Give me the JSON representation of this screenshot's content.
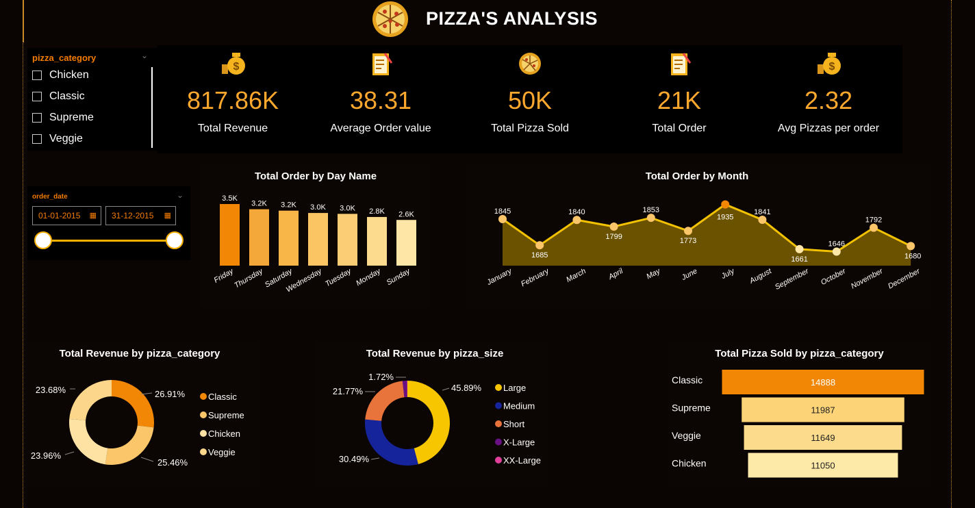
{
  "header": {
    "title": "PIZZA'S  ANALYSIS"
  },
  "slicer": {
    "title": "pizza_category",
    "options": [
      "Chicken",
      "Classic",
      "Supreme",
      "Veggie"
    ]
  },
  "date_slicer": {
    "title": "order_date",
    "start": "01-01-2015",
    "end": "31-12-2015"
  },
  "kpis": [
    {
      "value": "817.86K",
      "label": "Total Revenue",
      "icon": "money-bag-icon"
    },
    {
      "value": "38.31",
      "label": "Average Order value",
      "icon": "checklist-icon"
    },
    {
      "value": "50K",
      "label": "Total Pizza Sold",
      "icon": "pizza-icon"
    },
    {
      "value": "21K",
      "label": "Total Order",
      "icon": "checklist-icon"
    },
    {
      "value": "2.32",
      "label": "Avg Pizzas per order",
      "icon": "money-bag-icon"
    }
  ],
  "chart_data": [
    {
      "type": "bar",
      "title": "Total Order by Day Name",
      "categories": [
        "Friday",
        "Thursday",
        "Saturday",
        "Wednesday",
        "Tuesday",
        "Monday",
        "Sunday"
      ],
      "values": [
        3538,
        3239,
        3158,
        3024,
        2973,
        2794,
        2624
      ],
      "labels": [
        "3.5K",
        "3.2K",
        "3.2K",
        "3.0K",
        "3.0K",
        "2.8K",
        "2.6K"
      ],
      "colors": [
        "#f28705",
        "#f5a83a",
        "#f8b548",
        "#fac562",
        "#fbce75",
        "#fcda8e",
        "#fde6a6"
      ]
    },
    {
      "type": "area",
      "title": "Total Order by Month",
      "categories": [
        "January",
        "February",
        "March",
        "April",
        "May",
        "June",
        "July",
        "August",
        "September",
        "October",
        "November",
        "December"
      ],
      "values": [
        1845,
        1685,
        1840,
        1799,
        1853,
        1773,
        1935,
        1841,
        1661,
        1646,
        1792,
        1680
      ],
      "ylim": [
        1560,
        1950
      ]
    },
    {
      "type": "pie",
      "title": "Total Revenue by pizza_category",
      "categories": [
        "Classic",
        "Supreme",
        "Chicken",
        "Veggie"
      ],
      "values": [
        26.91,
        25.46,
        23.96,
        23.68
      ],
      "labels": [
        "26.91%",
        "25.46%",
        "23.96%",
        "23.68%"
      ],
      "colors": [
        "#f28705",
        "#fbc56a",
        "#fde2a4",
        "#fcd68a"
      ]
    },
    {
      "type": "pie",
      "title": "Total Revenue by pizza_size",
      "categories": [
        "Large",
        "Medium",
        "Short",
        "X-Large",
        "XX-Large"
      ],
      "values": [
        45.89,
        30.49,
        21.77,
        1.72,
        0.13
      ],
      "labels": [
        "45.89%",
        "30.49%",
        "21.77%",
        "1.72%",
        ""
      ],
      "colors": [
        "#f7c600",
        "#16249b",
        "#e8743b",
        "#6a1085",
        "#e0409a"
      ]
    },
    {
      "type": "bar",
      "title": "Total Pizza Sold by pizza_category",
      "categories": [
        "Classic",
        "Supreme",
        "Veggie",
        "Chicken"
      ],
      "values": [
        14888,
        11987,
        11649,
        11050
      ],
      "labels": [
        "14888",
        "11987",
        "11649",
        "11050"
      ],
      "colors": [
        "#f28705",
        "#fcd377",
        "#fcdc8c",
        "#fde9a8"
      ]
    }
  ]
}
